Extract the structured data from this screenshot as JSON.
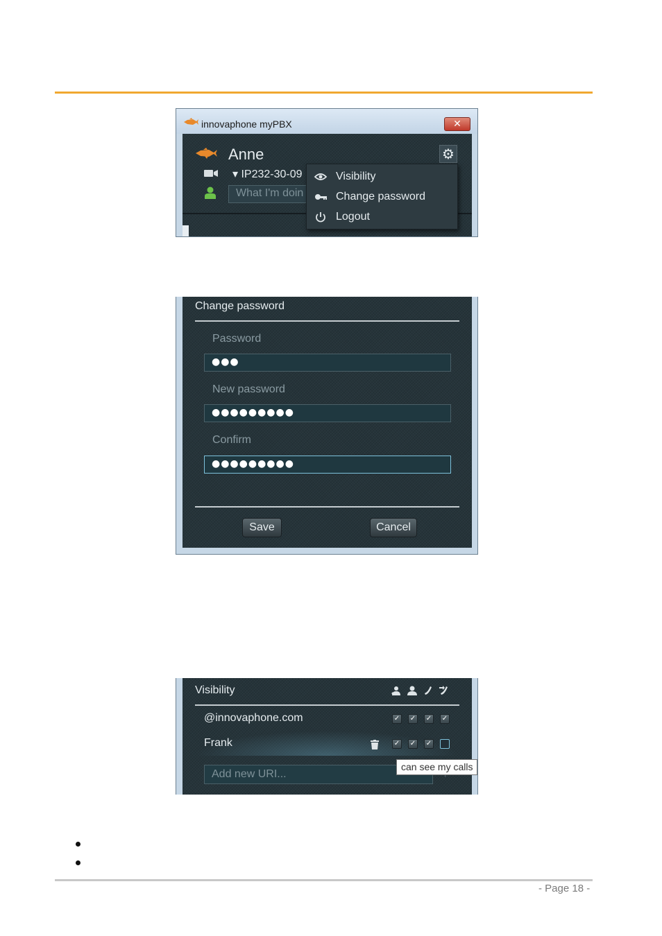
{
  "colors": {
    "accent_rule": "#f0a830",
    "bottom_rule": "#c8c8c8",
    "panel_bg": "#26343a",
    "window_frame": "#c6d7e6"
  },
  "shot1": {
    "window_title": "innovaphone myPBX",
    "close_glyph": "✕",
    "user_name": "Anne",
    "device": "▾ IP232-30-09",
    "status_placeholder": "What I'm doin",
    "gear_glyph": "⚙",
    "icons": [
      "fish-logo-icon",
      "close-icon",
      "gear-icon",
      "video-camera-icon",
      "presence-person-icon"
    ]
  },
  "settings_menu": {
    "items": [
      {
        "label": "Visibility",
        "icon": "eye-icon"
      },
      {
        "label": "Change password",
        "icon": "key-icon"
      },
      {
        "label": "Logout",
        "icon": "power-icon"
      }
    ]
  },
  "change_password": {
    "title": "Change password",
    "password_label": "Password",
    "password_value": "●●●",
    "new_password_label": "New password",
    "new_password_value": "●●●●●●●●●",
    "confirm_label": "Confirm",
    "confirm_value": "●●●●●●●●●",
    "save_label": "Save",
    "cancel_label": "Cancel"
  },
  "visibility": {
    "title": "Visibility",
    "column_icons": [
      "presence-icon",
      "person-icon",
      "phone-icon",
      "call-forward-icon"
    ],
    "rows": [
      {
        "name": "@innovaphone.com",
        "checks": [
          true,
          true,
          true,
          true
        ]
      },
      {
        "name": "Frank",
        "checks": [
          true,
          true,
          true,
          false
        ]
      }
    ],
    "add_placeholder": "Add new URI...",
    "add_glyph": "+",
    "tooltip": "can see my calls"
  },
  "footer": {
    "page_label": "- Page 18 -"
  }
}
